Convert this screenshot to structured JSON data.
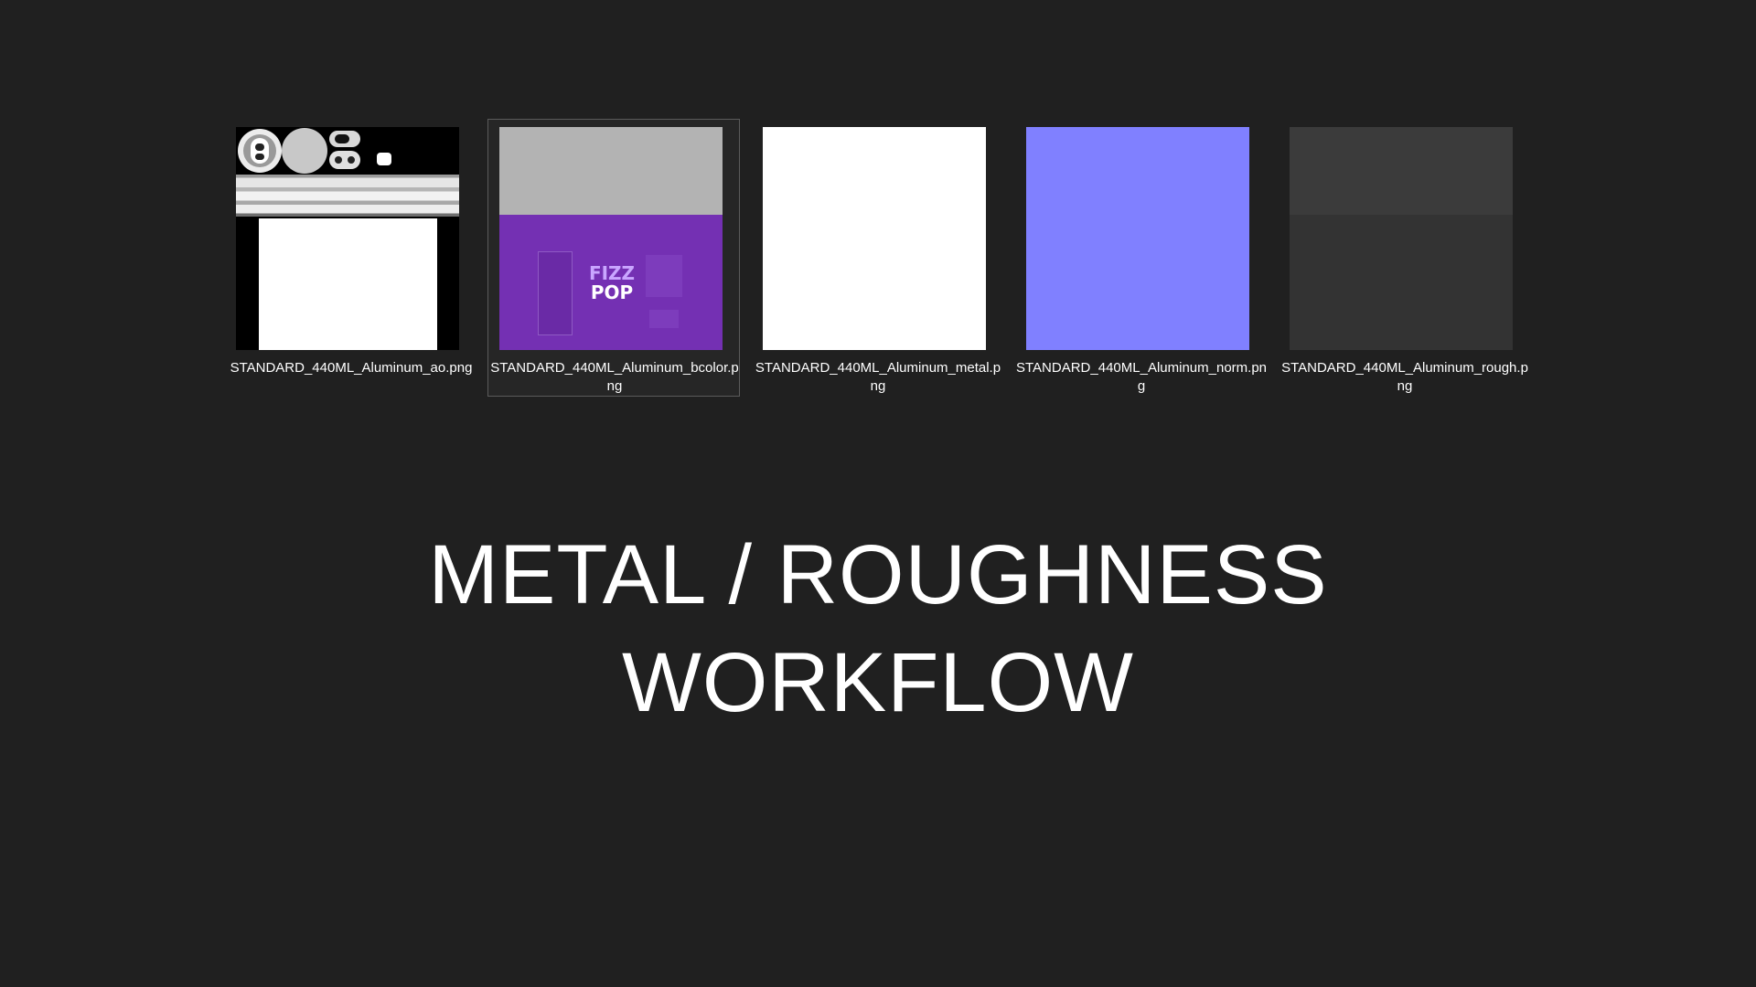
{
  "files": [
    {
      "name": "STANDARD_440ML_Aluminum_ao.png",
      "thumb": "ao",
      "selected": false
    },
    {
      "name": "STANDARD_440ML_Aluminum_bcolor.png",
      "thumb": "bcolor",
      "selected": true
    },
    {
      "name": "STANDARD_440ML_Aluminum_metal.png",
      "thumb": "metal",
      "selected": false
    },
    {
      "name": "STANDARD_440ML_Aluminum_norm.png",
      "thumb": "norm",
      "selected": false
    },
    {
      "name": "STANDARD_440ML_Aluminum_rough.png",
      "thumb": "rough",
      "selected": false
    }
  ],
  "thumb_text": {
    "logo_line1": "FIZZ",
    "logo_line2": "POP"
  },
  "headline": {
    "line1": "METAL / ROUGHNESS",
    "line2": "WORKFLOW"
  },
  "colors": {
    "background": "#202020",
    "selection_border": "#5b5b5b",
    "normal_map": "#8080ff",
    "label_purple": "#7430b3"
  }
}
